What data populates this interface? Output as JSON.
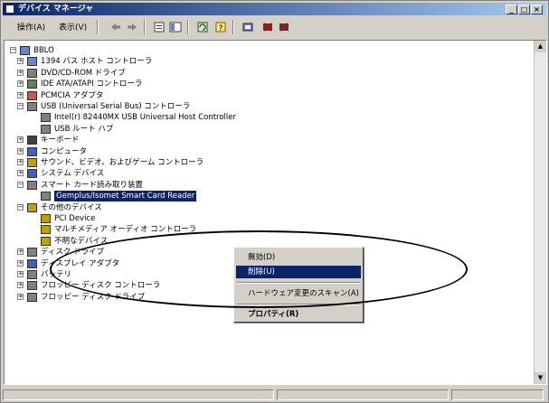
{
  "window": {
    "title": "デバイス マネージャ",
    "buttons": [
      "_",
      "□",
      "×"
    ]
  },
  "toolbar": {
    "menus": [
      "操作(A)",
      "表示(V)"
    ],
    "icons": [
      "back-arrow-icon",
      "forward-arrow-icon",
      "properties-icon",
      "view-icon",
      "refresh-icon",
      "help-icon",
      "scan-hardware-icon",
      "uninstall-icon",
      "disable-icon"
    ]
  },
  "tree": {
    "root": "BBLO",
    "items": [
      {
        "label": "1394 バス ホスト コントローラ",
        "expander": "+"
      },
      {
        "label": "DVD/CD-ROM ドライブ",
        "expander": "+"
      },
      {
        "label": "IDE ATA/ATAPI コントローラ",
        "expander": "+"
      },
      {
        "label": "PCMCIA アダプタ",
        "expander": "+"
      },
      {
        "label": "USB (Universal Serial Bus) コントローラ",
        "expander": "-"
      },
      {
        "label": "Intel(r) 82440MX USB Universal Host Controller",
        "child": true
      },
      {
        "label": "USB ルート ハブ",
        "child": true
      },
      {
        "label": "キーボード",
        "expander": "+"
      },
      {
        "label": "コンピュータ",
        "expander": "+"
      },
      {
        "label": "サウンド、ビデオ、およびゲーム コントローラ",
        "expander": "+"
      },
      {
        "label": "システム デバイス",
        "expander": "+"
      },
      {
        "label": "スマート カード読み取り装置",
        "expander": "-"
      },
      {
        "label": "Gemplus/Isomet Smart Card Reader",
        "child": true,
        "selected": true
      },
      {
        "label": "その他のデバイス",
        "expander": "-"
      },
      {
        "label": "PCI Device",
        "child": true
      },
      {
        "label": "マルチメディア オーディオ コントローラ",
        "child": true
      },
      {
        "label": "不明なデバイス",
        "child": true
      },
      {
        "label": "ディスク ドライブ",
        "expander": "+"
      },
      {
        "label": "ディスプレイ アダプタ",
        "expander": "+"
      },
      {
        "label": "バッテリ",
        "expander": "+"
      },
      {
        "label": "フロッピー ディスク コントローラ",
        "expander": "+"
      },
      {
        "label": "フロッピー ディスク ドライブ",
        "expander": "+"
      }
    ]
  },
  "context_menu": {
    "items": [
      "無効(D)",
      "削除(U)",
      "ハードウェア変更のスキャン(A)",
      "プロパティ(R)"
    ],
    "highlighted_index": 1
  },
  "colors": {
    "selection": "#0a246a",
    "face": "#d4d0c8"
  }
}
